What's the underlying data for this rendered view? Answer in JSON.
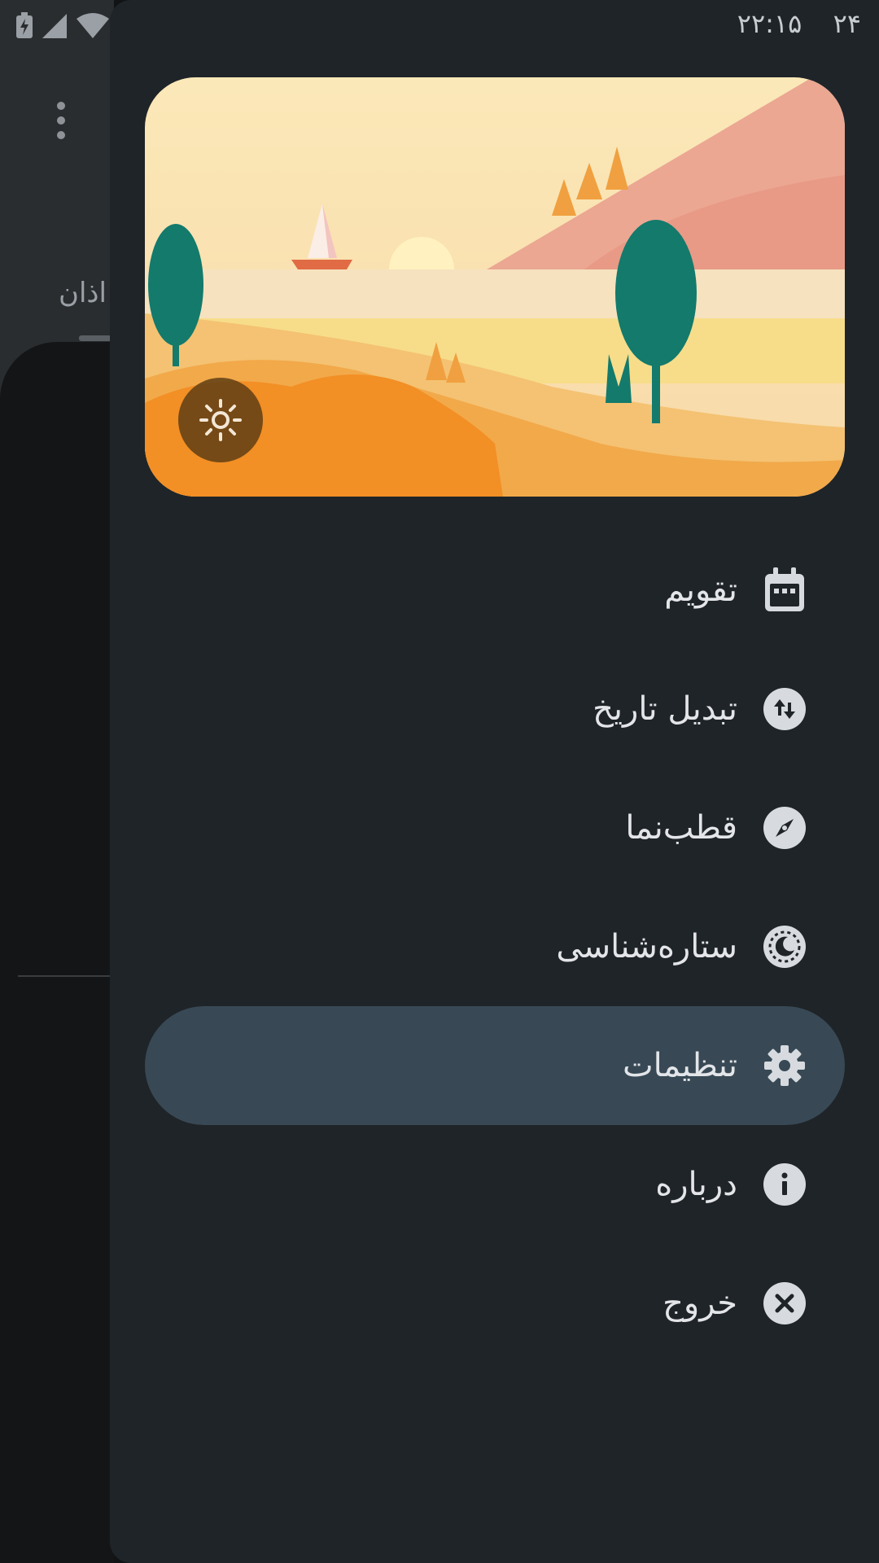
{
  "status_bar": {
    "time": "۲۲:۱۵",
    "extra": "۲۴"
  },
  "background_app": {
    "tab_label": "اذان"
  },
  "drawer": {
    "menu": [
      {
        "label": "تقویم",
        "icon": "calendar-icon"
      },
      {
        "label": "تبدیل تاریخ",
        "icon": "swap-vertical-icon"
      },
      {
        "label": "قطب‌نما",
        "icon": "compass-icon"
      },
      {
        "label": "ستاره‌شناسی",
        "icon": "astronomy-icon"
      },
      {
        "label": "تنظیمات",
        "icon": "gear-icon",
        "selected": true
      },
      {
        "label": "درباره",
        "icon": "info-icon"
      },
      {
        "label": "خروج",
        "icon": "close-icon"
      }
    ],
    "colors": {
      "drawer_bg": "#1f2428",
      "selected_bg": "#384955",
      "icon_circle": "#d7dbe0"
    }
  }
}
